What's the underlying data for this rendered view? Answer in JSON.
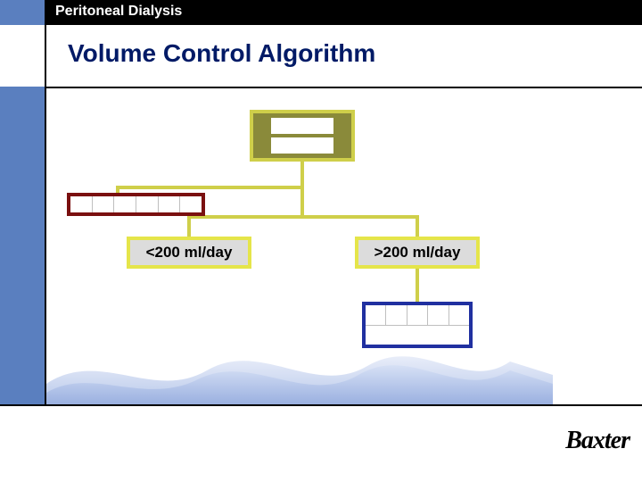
{
  "header": {
    "topic": "Peritoneal Dialysis"
  },
  "title": "Volume Control Algorithm",
  "diagram": {
    "branch_left_label": "<200 ml/day",
    "branch_right_label": ">200 ml/day"
  },
  "brand": "Baxter"
}
